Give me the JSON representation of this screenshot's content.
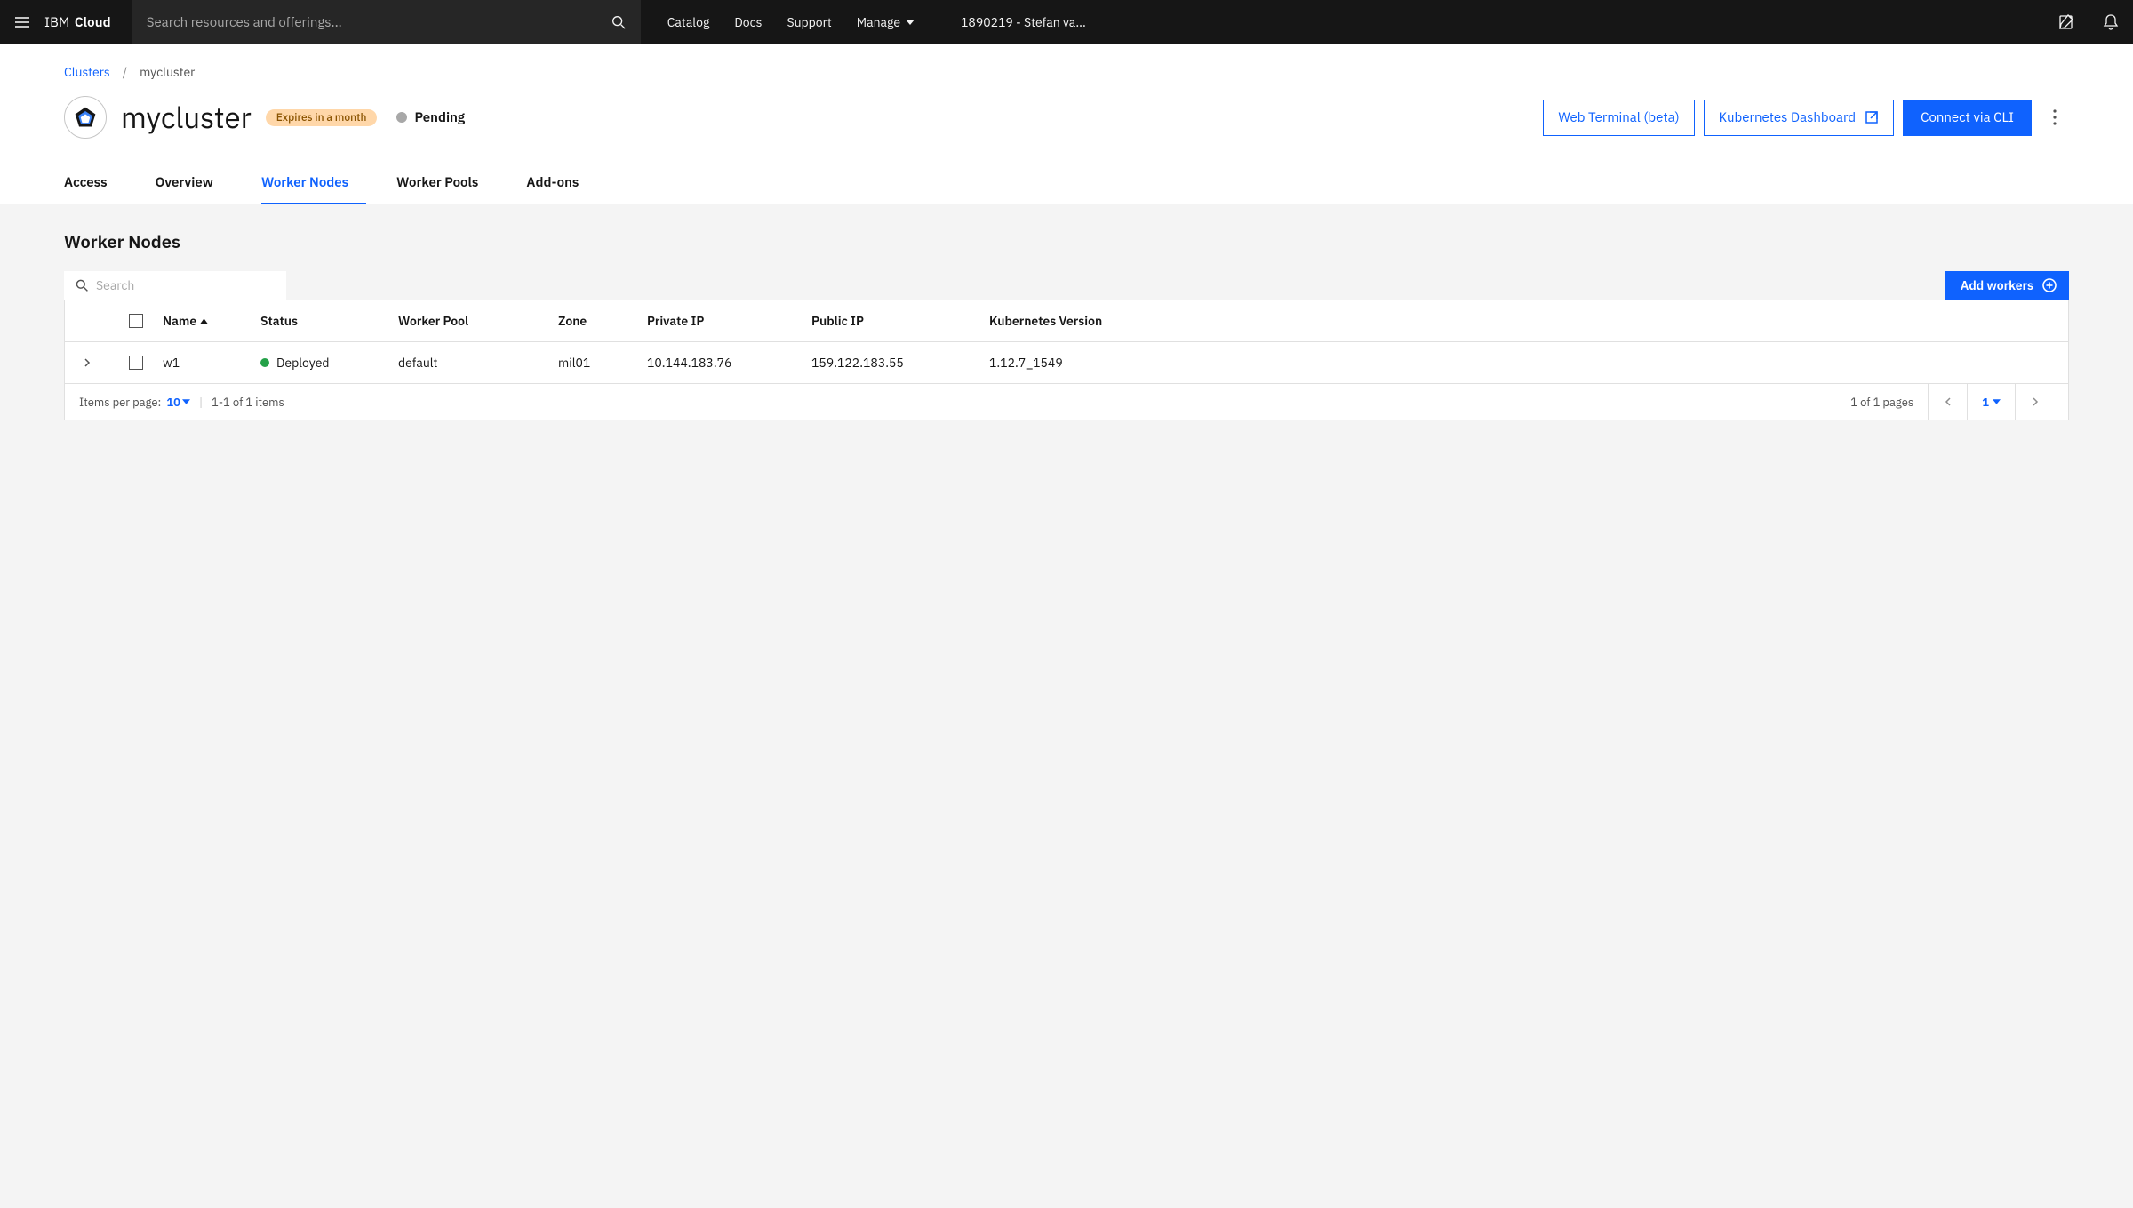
{
  "header": {
    "brand_prefix": "IBM",
    "brand_bold": "Cloud",
    "search_placeholder": "Search resources and offerings...",
    "nav": {
      "catalog": "Catalog",
      "docs": "Docs",
      "support": "Support",
      "manage": "Manage"
    },
    "account": "1890219 - Stefan va..."
  },
  "breadcrumb": {
    "root": "Clusters",
    "current": "mycluster"
  },
  "cluster": {
    "name": "mycluster",
    "expires_badge": "Expires in a month",
    "status_label": "Pending",
    "actions": {
      "web_terminal": "Web Terminal (beta)",
      "k8s_dashboard": "Kubernetes Dashboard",
      "connect_cli": "Connect via CLI"
    }
  },
  "tabs": {
    "access": "Access",
    "overview": "Overview",
    "worker_nodes": "Worker Nodes",
    "worker_pools": "Worker Pools",
    "addons": "Add-ons"
  },
  "section": {
    "title": "Worker Nodes",
    "search_placeholder": "Search",
    "add_workers": "Add workers"
  },
  "table": {
    "cols": {
      "name": "Name",
      "status": "Status",
      "worker_pool": "Worker Pool",
      "zone": "Zone",
      "private_ip": "Private IP",
      "public_ip": "Public IP",
      "k8s_version": "Kubernetes Version"
    },
    "rows": [
      {
        "name": "w1",
        "status": "Deployed",
        "worker_pool": "default",
        "zone": "mil01",
        "private_ip": "10.144.183.76",
        "public_ip": "159.122.183.55",
        "k8s_version": "1.12.7_1549"
      }
    ]
  },
  "pagination": {
    "ipp_label": "Items per page:",
    "ipp_value": "10",
    "range": "1-1 of 1 items",
    "pages_label": "1 of 1 pages",
    "current_page": "1"
  }
}
